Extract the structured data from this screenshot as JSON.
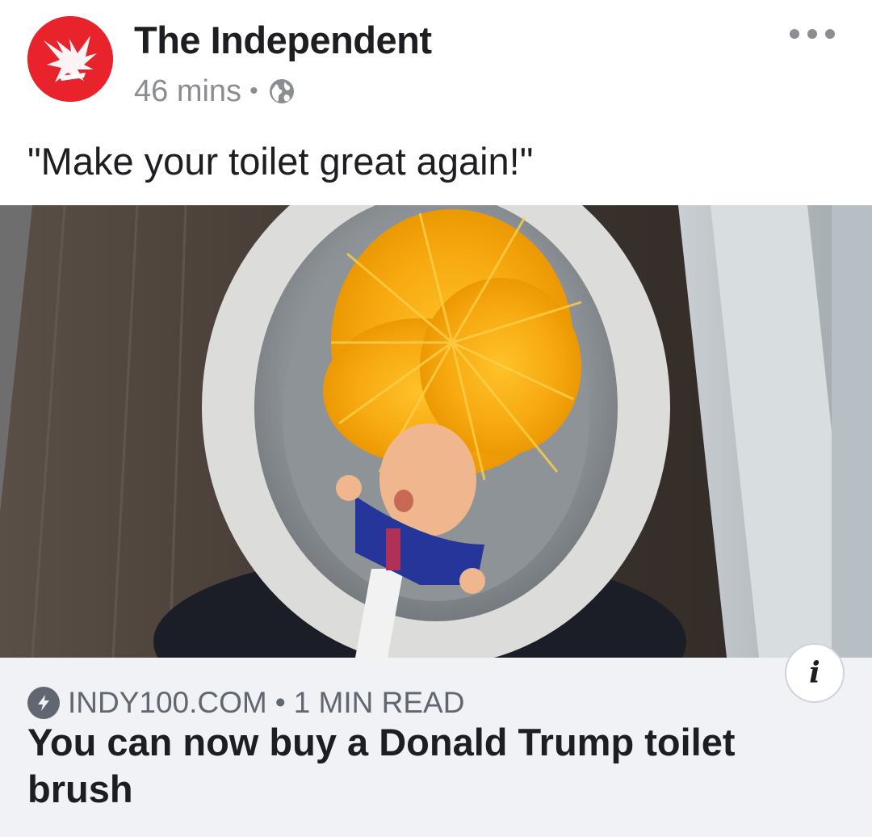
{
  "post": {
    "page_name": "The Independent",
    "time": "46 mins",
    "separator": "•",
    "privacy_icon": "globe-icon",
    "avatar_icon": "eagle-logo",
    "more_icon": "more-dots-icon",
    "caption": "\"Make your toilet great again!\""
  },
  "photo": {
    "alt": "Toilet brush with a figure head and orange bristles in a white toilet bowl"
  },
  "link": {
    "icon": "lightning-bolt-icon",
    "source": "INDY100.COM",
    "separator": "•",
    "read_time": "1 MIN READ",
    "title": "You can now buy a Donald Trump toilet brush",
    "info_icon": "info-icon",
    "info_label": "i"
  },
  "colors": {
    "brand_red": "#e8232c",
    "text_primary": "#1c1e21",
    "text_secondary": "#8a8d91",
    "card_background": "#f0f2f5"
  }
}
